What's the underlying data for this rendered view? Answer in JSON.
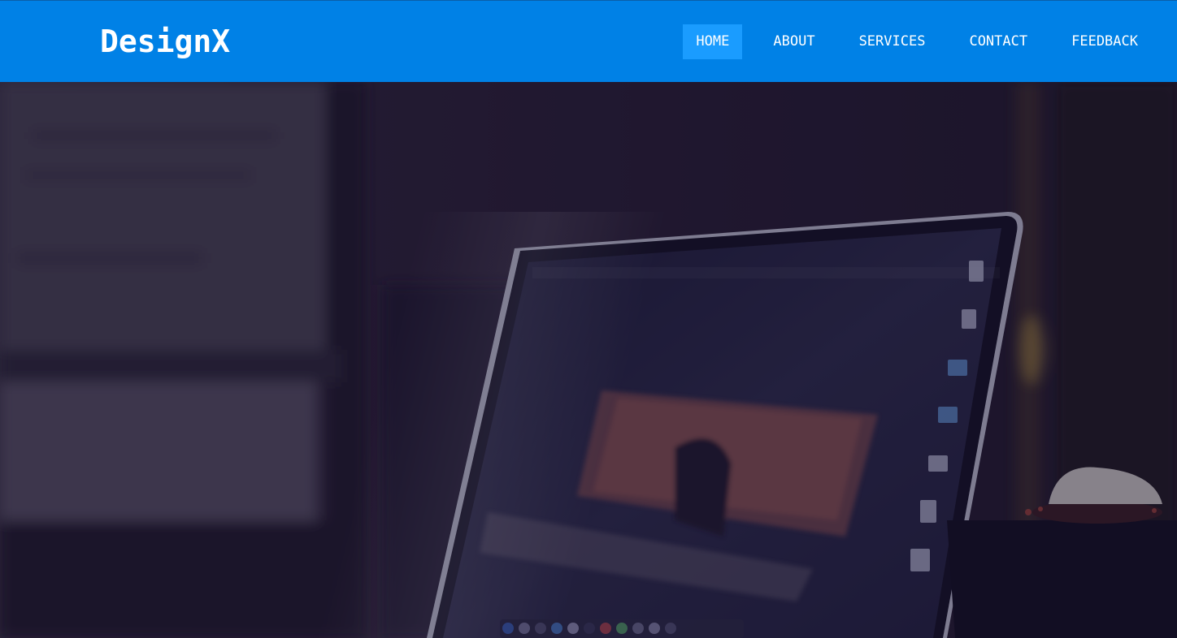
{
  "brand": {
    "name": "DesignX"
  },
  "nav": {
    "items": [
      {
        "label": "HOME",
        "active": true
      },
      {
        "label": "ABOUT",
        "active": false
      },
      {
        "label": "SERVICES",
        "active": false
      },
      {
        "label": "CONTACT",
        "active": false
      },
      {
        "label": "FEEDBACK",
        "active": false
      }
    ]
  },
  "colors": {
    "navbar": "#0081e6",
    "nav_active": "#1a9cff",
    "text": "#ffffff",
    "hero_overlay": "#1b1535"
  },
  "hero": {
    "image_subject": "laptop-photo-icon"
  }
}
